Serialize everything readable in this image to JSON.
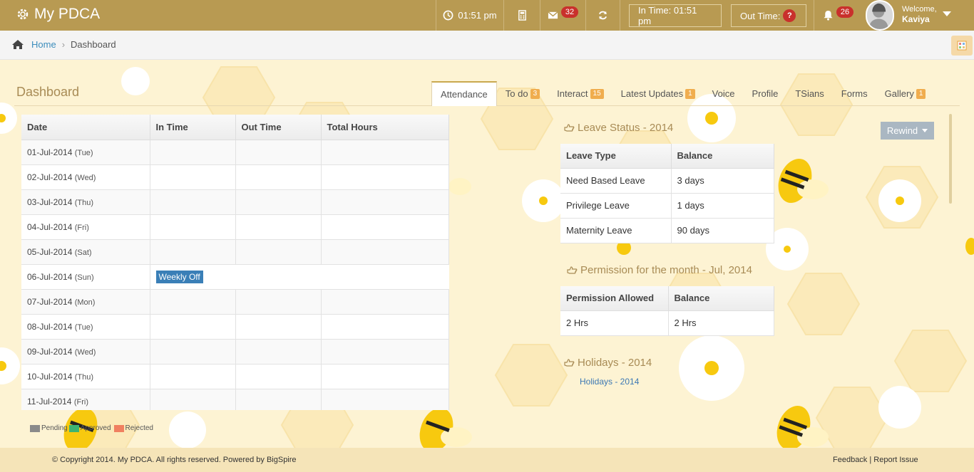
{
  "app": {
    "title": "My PDCA"
  },
  "topbar": {
    "clock": "01:51 pm",
    "mail_count": "32",
    "in_time": "In Time: 01:51 pm",
    "out_time": "Out Time:",
    "out_time_badge": "?",
    "notify_count": "26",
    "welcome": "Welcome,",
    "user": "Kaviya"
  },
  "breadcrumb": {
    "home": "Home",
    "current": "Dashboard"
  },
  "page": {
    "title": "Dashboard"
  },
  "tabs": [
    {
      "label": "Attendance",
      "badge": ""
    },
    {
      "label": "To do",
      "badge": "3"
    },
    {
      "label": "Interact",
      "badge": "15"
    },
    {
      "label": "Latest Updates",
      "badge": "1"
    },
    {
      "label": "Voice",
      "badge": ""
    },
    {
      "label": "Profile",
      "badge": ""
    },
    {
      "label": "TSians",
      "badge": ""
    },
    {
      "label": "Forms",
      "badge": ""
    },
    {
      "label": "Gallery",
      "badge": "1"
    }
  ],
  "attendance": {
    "columns": [
      "Date",
      "In Time",
      "Out Time",
      "Total Hours"
    ],
    "rows": [
      {
        "date": "01-Jul-2014",
        "day": "(Tue)"
      },
      {
        "date": "02-Jul-2014",
        "day": "(Wed)"
      },
      {
        "date": "03-Jul-2014",
        "day": "(Thu)"
      },
      {
        "date": "04-Jul-2014",
        "day": "(Fri)"
      },
      {
        "date": "05-Jul-2014",
        "day": "(Sat)"
      },
      {
        "date": "06-Jul-2014",
        "day": "(Sun)",
        "status": "Weekly Off"
      },
      {
        "date": "07-Jul-2014",
        "day": "(Mon)"
      },
      {
        "date": "08-Jul-2014",
        "day": "(Tue)"
      },
      {
        "date": "09-Jul-2014",
        "day": "(Wed)"
      },
      {
        "date": "10-Jul-2014",
        "day": "(Thu)"
      },
      {
        "date": "11-Jul-2014",
        "day": "(Fri)"
      }
    ]
  },
  "legend": [
    {
      "label": "Pending",
      "color": "#8a8a8a"
    },
    {
      "label": "Approved",
      "color": "#3cb371"
    },
    {
      "label": "Rejected",
      "color": "#f08060"
    }
  ],
  "rewind": {
    "label": "Rewind"
  },
  "leave": {
    "title": "Leave Status - 2014",
    "columns": [
      "Leave Type",
      "Balance"
    ],
    "rows": [
      [
        "Need Based Leave",
        "3 days"
      ],
      [
        "Privilege Leave",
        "1 days"
      ],
      [
        "Maternity Leave",
        "90 days"
      ]
    ]
  },
  "permission": {
    "title": "Permission for the month - Jul, 2014",
    "columns": [
      "Permission Allowed",
      "Balance"
    ],
    "rows": [
      [
        "2 Hrs",
        "2 Hrs"
      ]
    ]
  },
  "holidays": {
    "title": "Holidays - 2014",
    "link": "Holidays - 2014"
  },
  "footer": {
    "copyright": "© Copyright 2014. My PDCA. All rights reserved. Powered by BigSpire",
    "feedback": "Feedback",
    "separator": "|",
    "report": "Report Issue"
  },
  "colors": {
    "topbar": "#b89a52",
    "accent": "#a88b55",
    "badge": "#c9302c",
    "tab_badge": "#f0ad4e",
    "weekly_off": "#3a7fb7"
  }
}
